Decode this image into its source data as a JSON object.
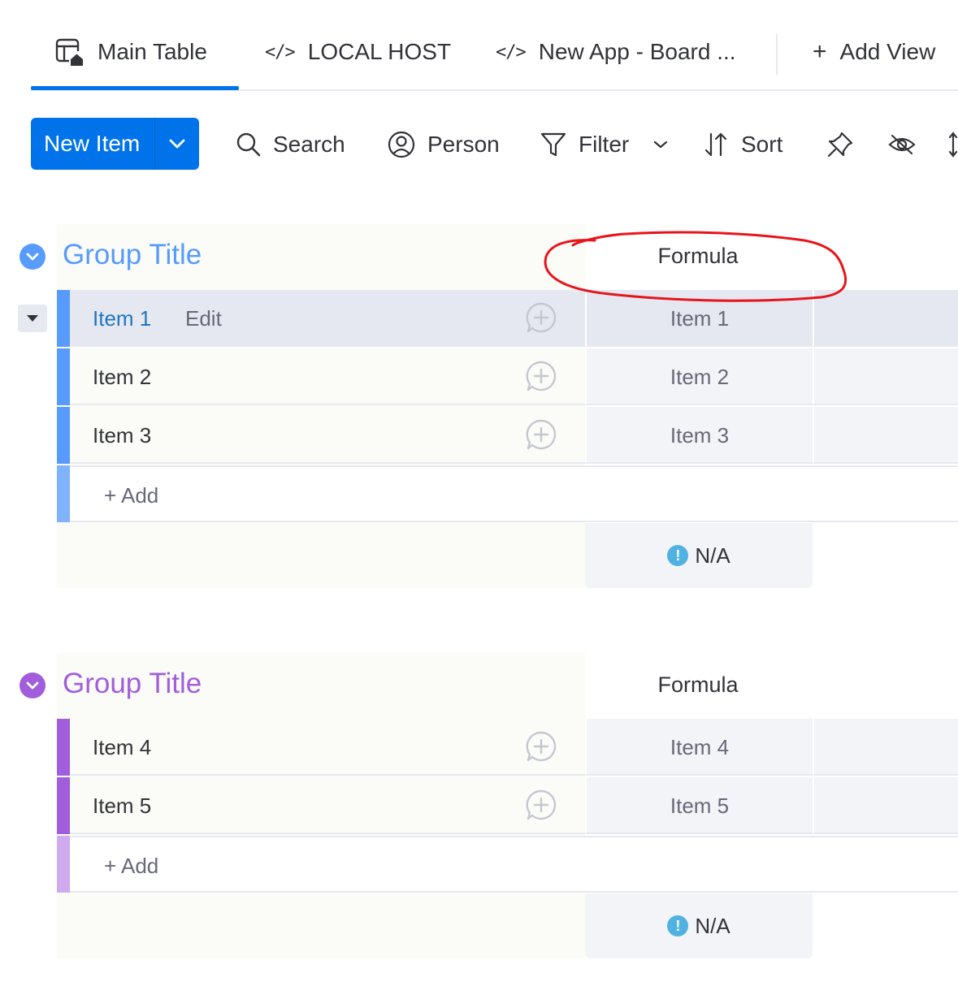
{
  "tabs": {
    "main_table": "Main Table",
    "local_host": "LOCAL HOST",
    "new_app": "New App - Board ...",
    "add_view": "Add View",
    "icons": {
      "main_table": "table-home-icon",
      "local_host": "code-icon",
      "new_app": "code-icon",
      "add_view": "plus-icon"
    }
  },
  "toolbar": {
    "new_item": "New Item",
    "search": "Search",
    "person": "Person",
    "filter": "Filter",
    "sort": "Sort"
  },
  "groups": [
    {
      "title": "Group Title",
      "color": "#579bfc",
      "light_color": "#7fb3fd",
      "column_header": "Formula",
      "rows": [
        {
          "name": "Item 1",
          "formula": "Item 1",
          "edit_label": "Edit",
          "selected": true
        },
        {
          "name": "Item 2",
          "formula": "Item 2"
        },
        {
          "name": "Item 3",
          "formula": "Item 3"
        }
      ],
      "add_label": "+ Add",
      "summary": "N/A"
    },
    {
      "title": "Group Title",
      "color": "#a25ddc",
      "light_color": "#cfaaee",
      "column_header": "Formula",
      "rows": [
        {
          "name": "Item 4",
          "formula": "Item 4"
        },
        {
          "name": "Item 5",
          "formula": "Item 5"
        }
      ],
      "add_label": "+ Add",
      "summary": "N/A"
    }
  ],
  "colors": {
    "accent": "#0073ea",
    "annotation": "#e8141b",
    "summary_info": "#4fb2e3"
  }
}
